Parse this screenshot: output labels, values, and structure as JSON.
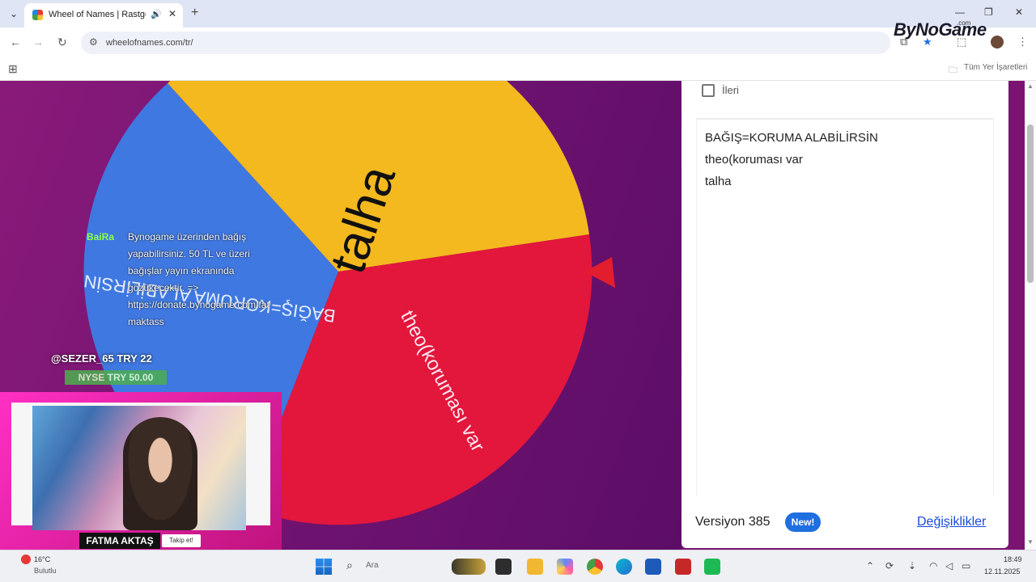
{
  "browser": {
    "tab_title": "Wheel of Names | Rastgele",
    "url": "wheelofnames.com/tr/",
    "bookmarks_label": "Tüm Yer İşaretleri",
    "watermark": "ByNoGame",
    "watermark_suffix": ".com"
  },
  "wheel": {
    "segments": [
      {
        "label": "talha",
        "color": "#f4b91f"
      },
      {
        "label": "theo(koruması var",
        "color": "#e3163c"
      },
      {
        "label": "BAĞIŞ=KORUMA ALABİLİRSİN",
        "color": "#3f78e0"
      }
    ],
    "pointer_color": "#e11d2e"
  },
  "stream_overlay": {
    "username": "BaiRa",
    "lines": [
      "Bynogame üzerinden bağış",
      "yapabilirsiniz. 50 TL ve üzeri",
      "bağışlar yayın ekranında",
      "gözükecektir. =>",
      "https://donate.bynogame.com/fat",
      "maktass"
    ],
    "tip_line": "@SEZER_65  TRY 22",
    "badge_text": "NYSE  TRY 50.00",
    "streamer_name": "FATMA AKTAŞ",
    "follow_label": "Takip et!"
  },
  "panel": {
    "advanced_label": "İleri",
    "names": [
      "BAĞIŞ=KORUMA ALABİLİRSİN",
      "theo(koruması var",
      "talha"
    ],
    "version_label": "Versiyon 385",
    "new_badge": "New!",
    "changes_link": "Değişiklikler"
  },
  "taskbar": {
    "weather_temp": "16°C",
    "weather_cond": "Bulutlu",
    "search_label": "Ara",
    "time": "18:49",
    "date": "12.11.2025"
  }
}
